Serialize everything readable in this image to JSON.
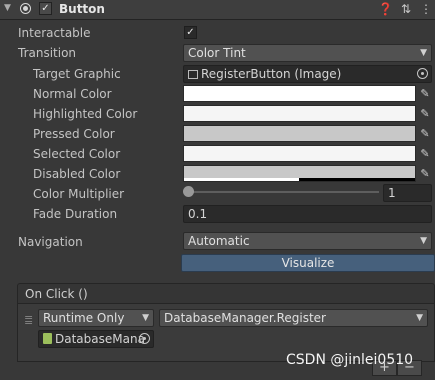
{
  "header": {
    "title": "Button",
    "enabled": true,
    "icons": [
      "help-icon",
      "presets-icon",
      "more-icon"
    ]
  },
  "properties": {
    "interactable": {
      "label": "Interactable",
      "checked": true
    },
    "transition": {
      "label": "Transition",
      "value": "Color Tint"
    },
    "target_graphic": {
      "label": "Target Graphic",
      "value": "RegisterButton (Image)"
    },
    "normal_color": {
      "label": "Normal Color",
      "color": "#ffffff",
      "alpha": 1.0
    },
    "highlighted_color": {
      "label": "Highlighted Color",
      "color": "#f5f5f5",
      "alpha": 1.0
    },
    "pressed_color": {
      "label": "Pressed Color",
      "color": "#c8c8c8",
      "alpha": 1.0
    },
    "selected_color": {
      "label": "Selected Color",
      "color": "#f5f5f5",
      "alpha": 1.0
    },
    "disabled_color": {
      "label": "Disabled Color",
      "color": "#c8c8c8",
      "alpha": 0.5
    },
    "color_multiplier": {
      "label": "Color Multiplier",
      "value": "1",
      "slider_fraction": 0.0
    },
    "fade_duration": {
      "label": "Fade Duration",
      "value": "0.1"
    }
  },
  "navigation": {
    "label": "Navigation",
    "value": "Automatic",
    "visualize_label": "Visualize"
  },
  "event": {
    "title": "On Click ()",
    "call_state": "Runtime Only",
    "function": "DatabaseManager.Register",
    "target_object": "DatabaseMana",
    "plus_label": "+",
    "minus_label": "−"
  },
  "watermark": "CSDN @jinlei0510",
  "colors": {
    "background": "#383838",
    "visualize_button": "#46607c"
  }
}
